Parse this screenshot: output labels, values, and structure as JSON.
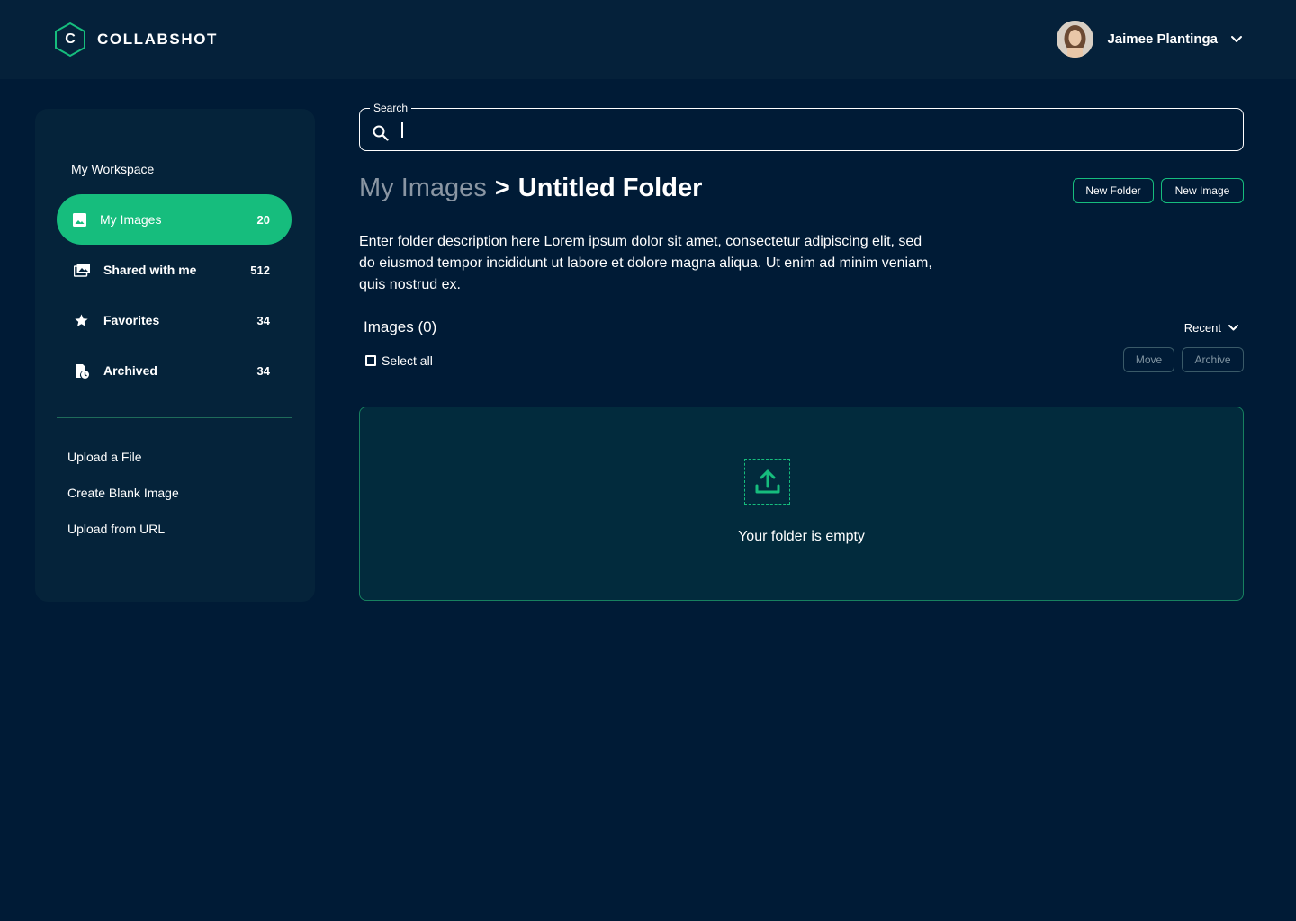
{
  "app": {
    "name": "COLLABSHOT",
    "logo_letter": "C"
  },
  "colors": {
    "background": "#001b36",
    "header": "#05213a",
    "sidebar": "#05233a",
    "accent": "#16bd7d",
    "empty_panel": "#022b3d"
  },
  "user": {
    "name": "Jaimee Plantinga"
  },
  "sidebar": {
    "workspace_title": "My Workspace",
    "items": [
      {
        "label": "My Images",
        "count": "20",
        "icon": "image-icon",
        "active": true
      },
      {
        "label": "Shared with me",
        "count": "512",
        "icon": "shared-images-icon",
        "active": false
      },
      {
        "label": "Favorites",
        "count": "34",
        "icon": "star-icon",
        "active": false
      },
      {
        "label": "Archived",
        "count": "34",
        "icon": "archive-clock-icon",
        "active": false
      }
    ],
    "actions": [
      {
        "label": "Upload a File"
      },
      {
        "label": "Create Blank Image"
      },
      {
        "label": "Upload from URL"
      }
    ]
  },
  "search": {
    "label": "Search",
    "value": "",
    "icon": "search-icon"
  },
  "breadcrumb": {
    "parent": "My Images",
    "separator": ">",
    "current": "Untitled Folder"
  },
  "toolbar": {
    "new_folder": "New Folder",
    "new_image": "New Image"
  },
  "folder": {
    "description": "Enter folder description here Lorem ipsum dolor sit amet, consectetur adipiscing elit, sed do eiusmod tempor incididunt ut labore et dolore magna aliqua. Ut enim ad minim veniam, quis nostrud ex."
  },
  "images": {
    "count_label": "Images (0)",
    "sort_label": "Recent",
    "select_all": "Select all",
    "move": "Move",
    "archive": "Archive",
    "empty_message": "Your folder is empty",
    "upload_icon": "upload-icon"
  }
}
